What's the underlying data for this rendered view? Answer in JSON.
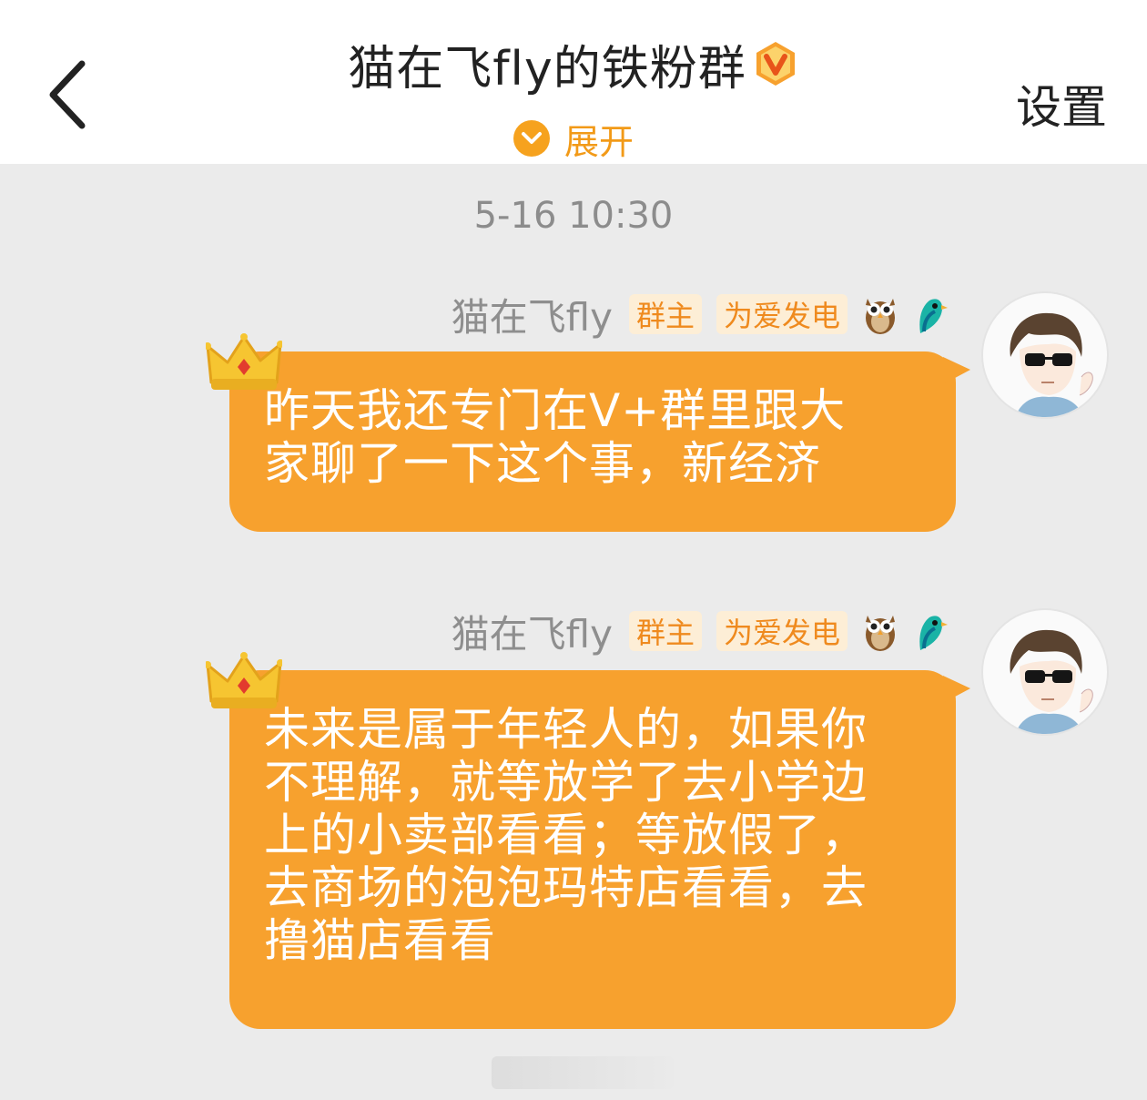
{
  "header": {
    "title": "猫在飞fly的铁粉群",
    "expand_label": "展开",
    "settings_label": "设置"
  },
  "timestamp": "5-16 10:30",
  "messages": [
    {
      "sender": "猫在飞fly",
      "tags": [
        "群主",
        "为爱发电"
      ],
      "text": "昨天我还专门在V+群里跟大家聊了一下这个事，新经济",
      "lines": [
        "昨天我还专门在V+群里跟大",
        "家聊了一下这个事，新经济"
      ]
    },
    {
      "sender": "猫在飞fly",
      "tags": [
        "群主",
        "为爱发电"
      ],
      "text": "未来是属于年轻人的，如果你不理解，就等放学了去小学边上的小卖部看看；等放假了，去商场的泡泡玛特店看看，去撸猫店看看",
      "lines": [
        "未来是属于年轻人的，如果你",
        "不理解，就等放学了去小学边",
        "上的小卖部看看；等放假了，",
        "去商场的泡泡玛特店看看，去",
        "撸猫店看看"
      ]
    }
  ],
  "colors": {
    "accent": "#f7a12e",
    "tag_bg": "#fdeed6",
    "tag_text": "#ef8a1e",
    "background": "#ebebeb"
  },
  "icons": [
    "back-arrow-icon",
    "verified-v-icon",
    "chevron-down-icon",
    "owl-medal-icon",
    "bird-medal-icon",
    "crown-icon",
    "avatar"
  ]
}
